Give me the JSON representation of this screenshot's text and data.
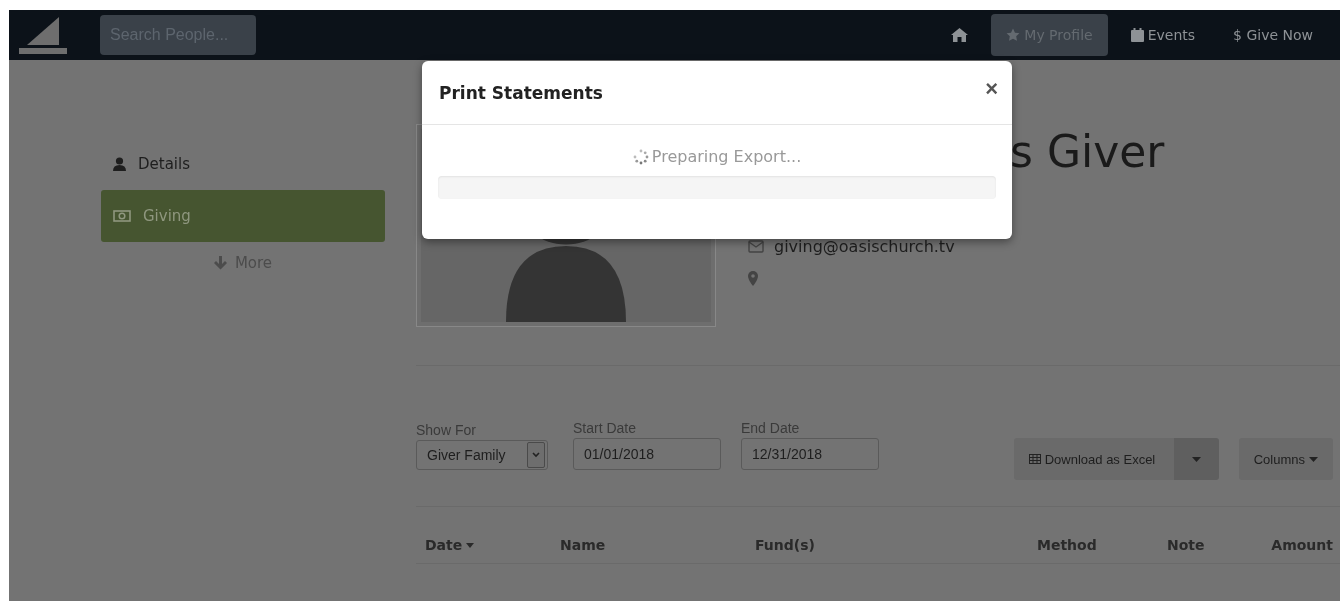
{
  "navbar": {
    "search": {
      "placeholder": "Search People..."
    },
    "items": [
      {
        "kind": "home",
        "selected": false
      },
      {
        "kind": "star",
        "label": "My Profile",
        "selected": true
      },
      {
        "kind": "calendar",
        "label": "Events",
        "selected": false
      },
      {
        "kind": "text",
        "label": "$ Give Now",
        "selected": false
      }
    ]
  },
  "sidebar": {
    "items": [
      {
        "kind": "user",
        "label": "Details",
        "selected": false
      },
      {
        "kind": "money",
        "label": "Giving",
        "selected": true
      }
    ],
    "more": "More"
  },
  "profile": {
    "name": "s Giver",
    "email": "giving@oasischurch.tv"
  },
  "filters": {
    "show_for": {
      "label": "Show For",
      "value": "Giver Family"
    },
    "start_date": {
      "label": "Start Date",
      "value": "01/01/2018"
    },
    "end_date": {
      "label": "End Date",
      "value": "12/31/2018"
    },
    "download_button": "Download as Excel",
    "columns_button": "Columns"
  },
  "table": {
    "columns": [
      {
        "label": "Date",
        "sorted": true
      },
      {
        "label": "Name",
        "sorted": false
      },
      {
        "label": "Fund(s)",
        "sorted": false
      },
      {
        "label": "Method",
        "sorted": false
      },
      {
        "label": "Note",
        "sorted": false
      },
      {
        "label": "Amount",
        "sorted": false
      }
    ]
  },
  "modal": {
    "title": "Print Statements",
    "close": "×",
    "status": "Preparing Export...",
    "progress": {
      "level": 0
    }
  }
}
